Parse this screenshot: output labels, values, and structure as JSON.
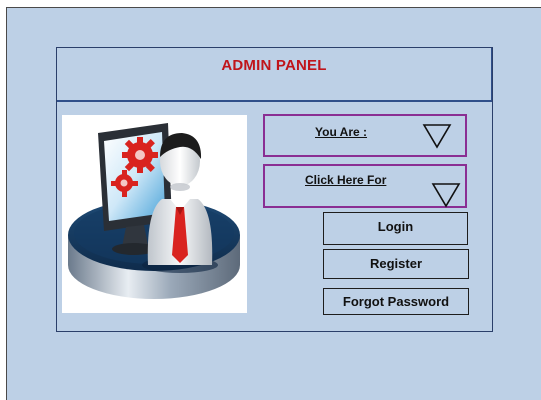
{
  "header": {
    "title": "ADMIN PANEL"
  },
  "image": {
    "icon": "admin-user-computer-icon"
  },
  "dropdowns": {
    "role": {
      "label": "You Are :",
      "icon": "triangle-down-icon"
    },
    "action": {
      "label": "Click Here For",
      "icon": "triangle-down-icon"
    }
  },
  "buttons": {
    "login": "Login",
    "register": "Register",
    "forgot_password": "Forgot Password"
  },
  "colors": {
    "background": "#bdd0e6",
    "title": "#c0141a",
    "dropdown_border": "#8a2e93",
    "panel_border": "#2b3f6a"
  }
}
